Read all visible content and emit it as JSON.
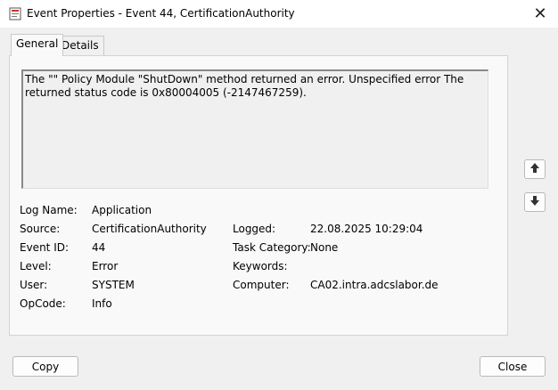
{
  "window": {
    "title": "Event Properties - Event 44, CertificationAuthority",
    "close_glyph": "✕"
  },
  "tabs": [
    {
      "label": "General",
      "active": true
    },
    {
      "label": "Details",
      "active": false
    }
  ],
  "description": "The \"\" Policy Module \"ShutDown\" method returned an error. Unspecified error The returned status code is 0x80004005 (-2147467259).",
  "fields": {
    "log_name": {
      "label": "Log Name:",
      "value": "Application"
    },
    "source": {
      "label": "Source:",
      "value": "CertificationAuthority"
    },
    "event_id": {
      "label": "Event ID:",
      "value": "44"
    },
    "level": {
      "label": "Level:",
      "value": "Error"
    },
    "user": {
      "label": "User:",
      "value": "SYSTEM"
    },
    "opcode": {
      "label": "OpCode:",
      "value": "Info"
    },
    "logged": {
      "label": "Logged:",
      "value": "22.08.2025 10:29:04"
    },
    "task_category": {
      "label": "Task Category:",
      "value": "None"
    },
    "keywords": {
      "label": "Keywords:",
      "value": ""
    },
    "computer": {
      "label": "Computer:",
      "value": "CA02.intra.adcslabor.de"
    }
  },
  "buttons": {
    "copy": "Copy",
    "close": "Close"
  },
  "icons": {
    "title_icon": "event-log-icon",
    "up": "arrow-up-icon",
    "down": "arrow-down-icon"
  }
}
